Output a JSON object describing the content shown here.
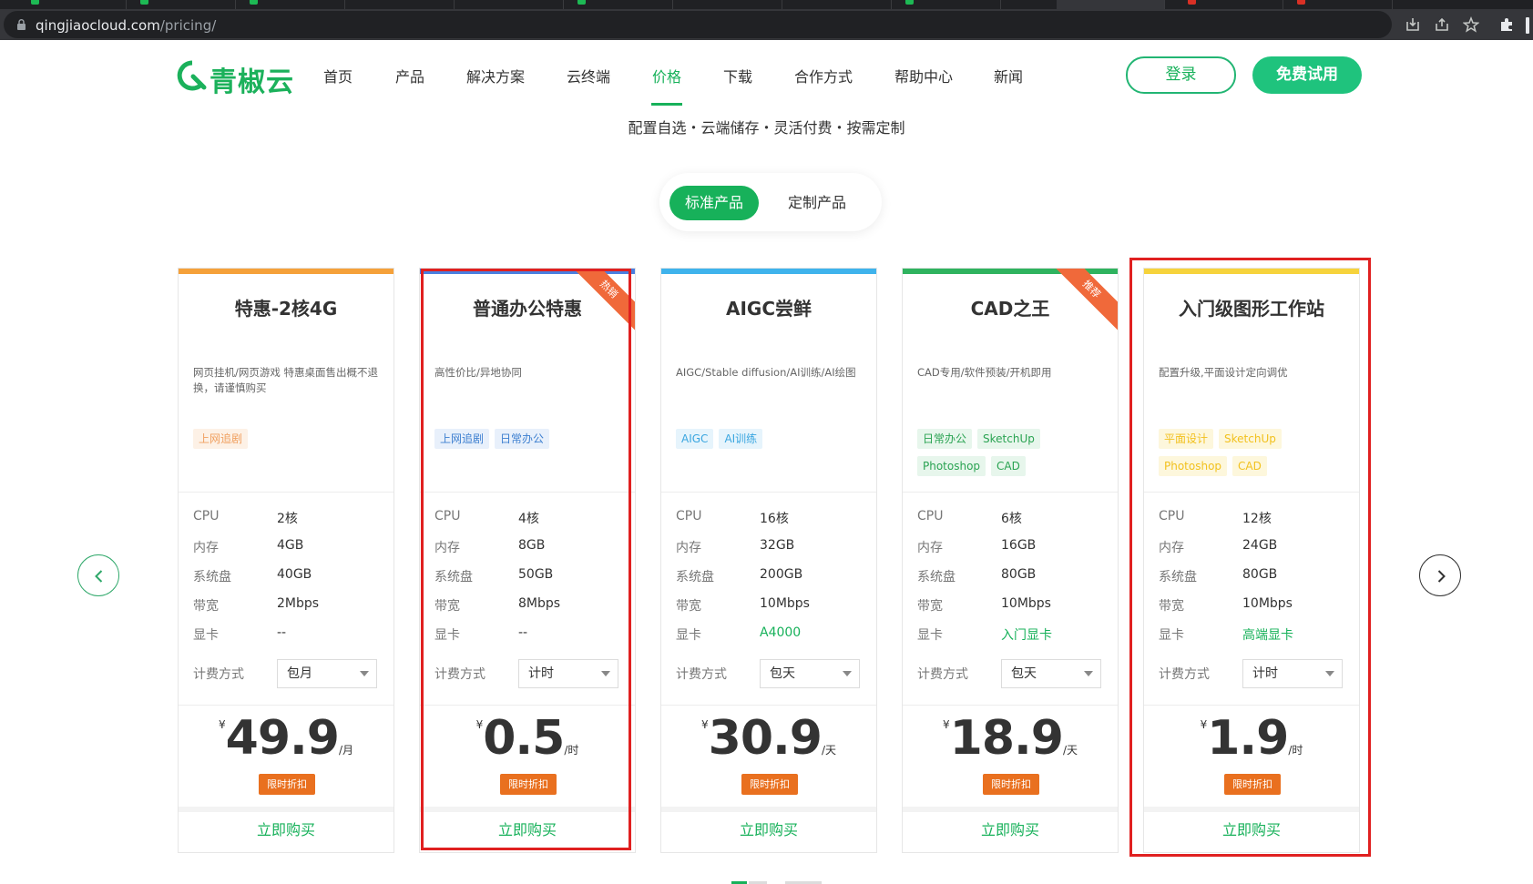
{
  "browser": {
    "url_host": "qingjiaocloud.com",
    "url_path": "/pricing/"
  },
  "header": {
    "logo_text": "青椒云",
    "nav": [
      "首页",
      "产品",
      "解决方案",
      "云终端",
      "价格",
      "下载",
      "合作方式",
      "帮助中心",
      "新闻"
    ],
    "active_nav": "价格",
    "login_label": "登录",
    "trial_label": "免费试用"
  },
  "slogan": "配置自选・云端储存・灵活付费・按需定制",
  "toggle": {
    "active": "标准产品",
    "inactive": "定制产品"
  },
  "spec_labels": {
    "cpu": "CPU",
    "memory": "内存",
    "disk": "系统盘",
    "bandwidth": "带宽",
    "gpu": "显卡",
    "billing": "计费方式"
  },
  "buy_label": "立即购买",
  "discount_label": "限时折扣",
  "currency": "¥",
  "cards": [
    {
      "title": "特惠-2核4G",
      "accent": "#f5a13a",
      "desc": "网页挂机/网页游戏 特惠桌面售出概不退换，请谨慎购买",
      "tags": [
        {
          "text": "上网追剧",
          "fg": "#f0a060",
          "bg": "#fdf1e6"
        }
      ],
      "ribbon": "",
      "cpu": "2核",
      "memory": "4GB",
      "disk": "40GB",
      "bandwidth": "2Mbps",
      "gpu": "--",
      "gpu_green": false,
      "billing": "包月",
      "price": "49.9",
      "unit": "/月"
    },
    {
      "title": "普通办公特惠",
      "accent": "#4a7fe0",
      "desc": "高性价比/异地协同",
      "tags": [
        {
          "text": "上网追剧",
          "fg": "#3d7fd0",
          "bg": "#e8f0fb"
        },
        {
          "text": "日常办公",
          "fg": "#3d7fd0",
          "bg": "#e8f0fb"
        }
      ],
      "ribbon": "热销",
      "cpu": "4核",
      "memory": "8GB",
      "disk": "50GB",
      "bandwidth": "8Mbps",
      "gpu": "--",
      "gpu_green": false,
      "billing": "计时",
      "price": "0.5",
      "unit": "/时"
    },
    {
      "title": "AIGC尝鲜",
      "accent": "#3fb3ec",
      "desc": "AIGC/Stable diffusion/AI训练/AI绘图",
      "tags": [
        {
          "text": "AIGC",
          "fg": "#3aa6e0",
          "bg": "#e6f4fc"
        },
        {
          "text": "AI训练",
          "fg": "#3aa6e0",
          "bg": "#e6f4fc"
        }
      ],
      "ribbon": "",
      "cpu": "16核",
      "memory": "32GB",
      "disk": "200GB",
      "bandwidth": "10Mbps",
      "gpu": "A4000",
      "gpu_green": true,
      "billing": "包天",
      "price": "30.9",
      "unit": "/天"
    },
    {
      "title": "CAD之王",
      "accent": "#2fb35f",
      "desc": "CAD专用/软件预装/开机即用",
      "tags": [
        {
          "text": "日常办公",
          "fg": "#2aa352",
          "bg": "#e7f6ec"
        },
        {
          "text": "SketchUp",
          "fg": "#2aa352",
          "bg": "#e7f6ec"
        },
        {
          "text": "Photoshop",
          "fg": "#2aa352",
          "bg": "#e7f6ec"
        },
        {
          "text": "CAD",
          "fg": "#2aa352",
          "bg": "#e7f6ec"
        }
      ],
      "ribbon": "推荐",
      "cpu": "6核",
      "memory": "16GB",
      "disk": "80GB",
      "bandwidth": "10Mbps",
      "gpu": "入门显卡",
      "gpu_green": true,
      "billing": "包天",
      "price": "18.9",
      "unit": "/天"
    },
    {
      "title": "入门级图形工作站",
      "accent": "#f6d33c",
      "desc": "配置升级,平面设计定向调优",
      "tags": [
        {
          "text": "平面设计",
          "fg": "#f2c11e",
          "bg": "#fdf7dc"
        },
        {
          "text": "SketchUp",
          "fg": "#f2c11e",
          "bg": "#fdf7dc"
        },
        {
          "text": "Photoshop",
          "fg": "#f2c11e",
          "bg": "#fdf7dc"
        },
        {
          "text": "CAD",
          "fg": "#f2c11e",
          "bg": "#fdf7dc"
        }
      ],
      "ribbon": "",
      "cpu": "12核",
      "memory": "24GB",
      "disk": "80GB",
      "bandwidth": "10Mbps",
      "gpu": "高端显卡",
      "gpu_green": true,
      "billing": "计时",
      "price": "1.9",
      "unit": "/时"
    }
  ],
  "colors": {
    "brand": "#17b15a",
    "highlight": "#e02020",
    "discount": "#e9701f"
  },
  "icons": [
    "lock-icon",
    "install-icon",
    "share-icon",
    "star-icon",
    "extensions-icon",
    "chevron-left-icon",
    "chevron-right-icon"
  ]
}
